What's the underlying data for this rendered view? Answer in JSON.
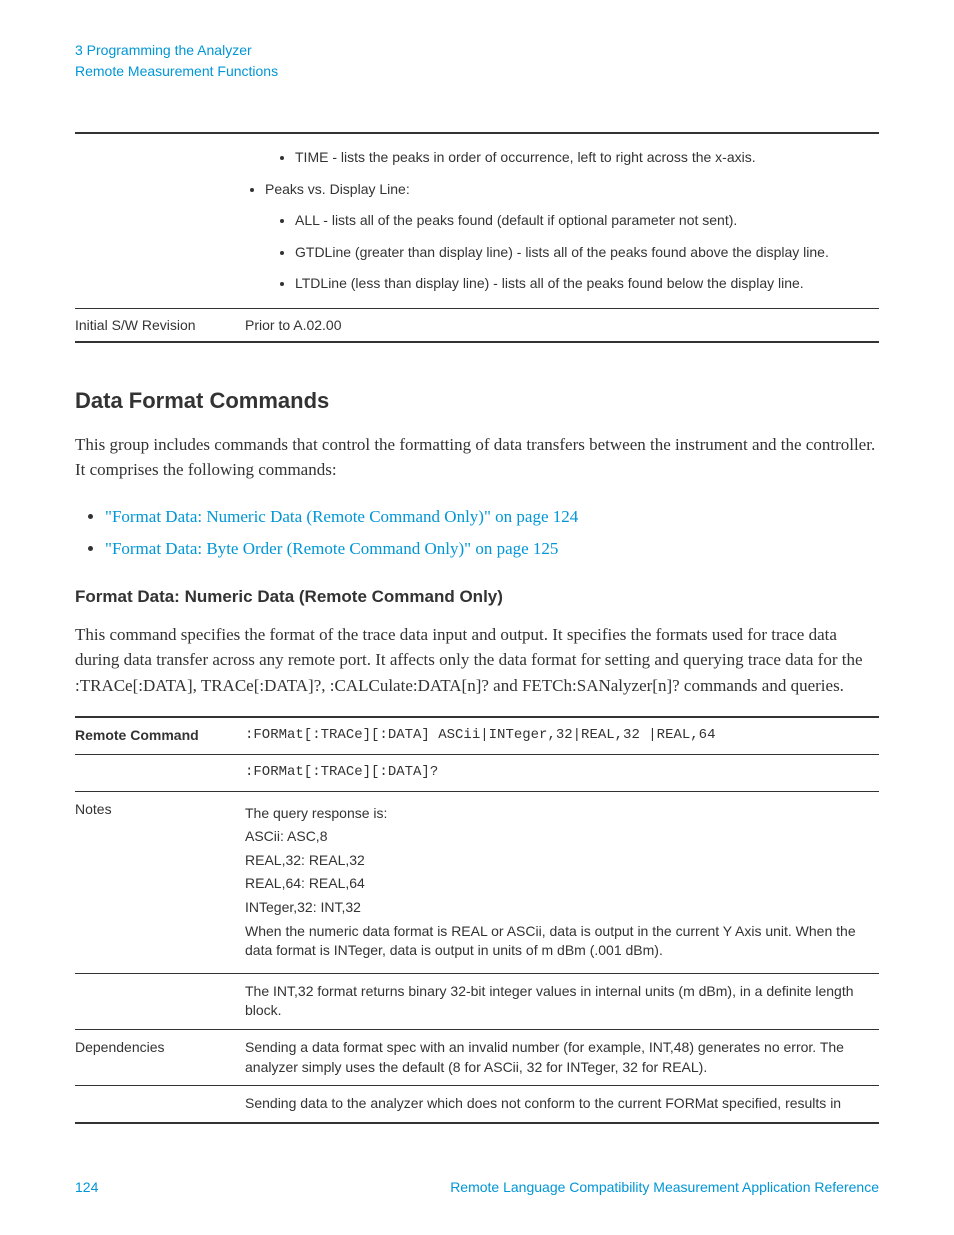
{
  "header": {
    "line1": "3  Programming the Analyzer",
    "line2": "Remote Measurement Functions"
  },
  "topTable": {
    "bullets": {
      "time": "TIME - lists the peaks in order of occurrence, left to right across the x-axis.",
      "peaksVs": "Peaks vs. Display Line:",
      "all": "ALL - lists all of the peaks found (default if optional parameter not sent).",
      "gtd": "GTDLine (greater than display line) - lists all of the peaks found above the display line.",
      "ltd": "LTDLine (less than display line) - lists all of the peaks found below the display line."
    },
    "revisionLabel": "Initial S/W Revision",
    "revisionValue": "Prior to A.02.00"
  },
  "section": {
    "heading": "Data Format Commands",
    "intro": "This group includes commands that control the formatting of data transfers between the instrument and the controller. It comprises the following commands:",
    "links": {
      "link1": "\"Format Data: Numeric Data (Remote Command Only)\" on page 124",
      "link2": "\"Format Data: Byte Order (Remote Command Only)\" on page 125"
    }
  },
  "subsection": {
    "heading": "Format Data: Numeric Data (Remote Command Only)",
    "intro": "This command specifies the format of the trace data input and output. It specifies the formats used for trace data during data transfer across any remote port. It affects only the data format for setting and querying trace data for the :TRACe[:DATA], TRACe[:DATA]?, :CALCulate:DATA[n]? and FETCh:SANalyzer[n]? commands and queries."
  },
  "cmdTable": {
    "remoteCmdLabel": "Remote Command",
    "cmd1": ":FORMat[:TRACe][:DATA] ASCii|INTeger,32|REAL,32 |REAL,64",
    "cmd2": ":FORMat[:TRACe][:DATA]?",
    "notesLabel": "Notes",
    "notes": {
      "n1": "The query response is:",
      "n2": "ASCii: ASC,8",
      "n3": "REAL,32: REAL,32",
      "n4": "REAL,64: REAL,64",
      "n5": "INTeger,32: INT,32",
      "n6": "When the numeric data format is REAL or ASCii, data is output in the current Y Axis unit. When the data format is INTeger, data is output in units of m dBm (.001 dBm).",
      "n7": "The INT,32 format returns binary 32-bit integer values in internal units (m dBm), in a definite length block."
    },
    "depsLabel": "Dependencies",
    "deps": {
      "d1": "Sending a data format spec with an invalid number (for example, INT,48) generates no error. The analyzer simply uses the default (8 for ASCii, 32 for INTeger, 32 for REAL).",
      "d2": "Sending data to the analyzer which does not conform to the current FORMat specified, results in"
    }
  },
  "footer": {
    "pageNum": "124",
    "docTitle": "Remote Language Compatibility Measurement Application Reference"
  }
}
